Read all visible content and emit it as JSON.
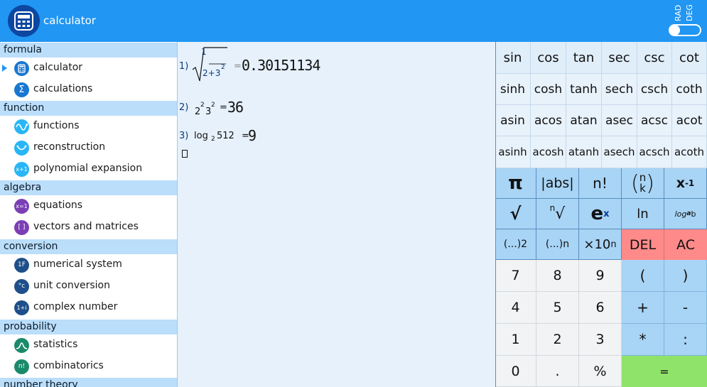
{
  "app": {
    "title": "calculator",
    "accent": "#2196f3"
  },
  "mode": {
    "rad": "RAD",
    "deg": "DEG"
  },
  "sidebar": {
    "sections": [
      {
        "label": "formula",
        "items": [
          {
            "label": "calculator",
            "icon": "calculator-icon",
            "selected": true
          },
          {
            "label": "calculations",
            "icon": "sigma-icon"
          }
        ]
      },
      {
        "label": "function",
        "items": [
          {
            "label": "functions",
            "icon": "sine-wave-icon"
          },
          {
            "label": "reconstruction",
            "icon": "curve-icon"
          },
          {
            "label": "polynomial expansion",
            "icon": "polynomial-icon",
            "glyph": "x+1"
          }
        ]
      },
      {
        "label": "algebra",
        "items": [
          {
            "label": "equations",
            "icon": "equation-icon",
            "glyph": "x=1"
          },
          {
            "label": "vectors and matrices",
            "icon": "matrix-icon",
            "glyph": "[ ]"
          }
        ]
      },
      {
        "label": "conversion",
        "items": [
          {
            "label": "numerical system",
            "icon": "numeral-system-icon",
            "glyph": "1F"
          },
          {
            "label": "unit conversion",
            "icon": "thermometer-icon",
            "glyph": "°c"
          },
          {
            "label": "complex number",
            "icon": "complex-icon",
            "glyph": "1+i"
          }
        ]
      },
      {
        "label": "probability",
        "items": [
          {
            "label": "statistics",
            "icon": "bell-curve-icon"
          },
          {
            "label": "combinatorics",
            "icon": "factorial-icon",
            "glyph": "n!"
          }
        ]
      },
      {
        "label": "number theory",
        "items": []
      }
    ]
  },
  "work": {
    "entries": [
      {
        "index": "1)",
        "num": "1",
        "den_base": "2+3",
        "den_exp": "2",
        "eq": "=",
        "result": "0.30151134"
      },
      {
        "index": "2)",
        "b1": "2",
        "e1": "2",
        "b2": "3",
        "e2": "2",
        "eq": "=",
        "result": "36"
      },
      {
        "index": "3)",
        "fn": "log",
        "sub": "2",
        "arg": "512",
        "eq": "=",
        "result": "9"
      }
    ]
  },
  "keypad": {
    "trig": [
      "sin",
      "cos",
      "tan",
      "sec",
      "csc",
      "cot",
      "sinh",
      "cosh",
      "tanh",
      "sech",
      "csch",
      "coth",
      "asin",
      "acos",
      "atan",
      "asec",
      "acsc",
      "acot",
      "asinh",
      "acosh",
      "atanh",
      "asech",
      "acsch",
      "acoth"
    ],
    "fn": {
      "pi": "π",
      "abs": "|abs|",
      "fact": "n!",
      "binom_n": "n",
      "binom_k": "k",
      "recip_x": "x",
      "recip_e": "-1",
      "sqrt": "√",
      "nroot_n": "n",
      "nroot": "√",
      "exp_e": "e",
      "exp_x": "x",
      "ln": "ln",
      "log_log": "log",
      "log_a": "a",
      "log_b": " b",
      "pow2_base": "(...)",
      "pow2_exp": "2",
      "pown_base": "(...)",
      "pown_exp": "n",
      "sci_base": "×10",
      "sci_exp": "n",
      "del": "DEL",
      "ac": "AC"
    },
    "rows": [
      [
        "7",
        "8",
        "9",
        "(",
        ")"
      ],
      [
        "4",
        "5",
        "6",
        "+",
        "-"
      ],
      [
        "1",
        "2",
        "3",
        "*",
        ":"
      ],
      [
        "0",
        ".",
        "%",
        "="
      ]
    ],
    "colors": {
      "fn": "#a8d4f5",
      "num": "#f1f3f5",
      "del": "#ff8a8a",
      "equals": "#8fe36a",
      "trig": "#e0eefa"
    }
  }
}
